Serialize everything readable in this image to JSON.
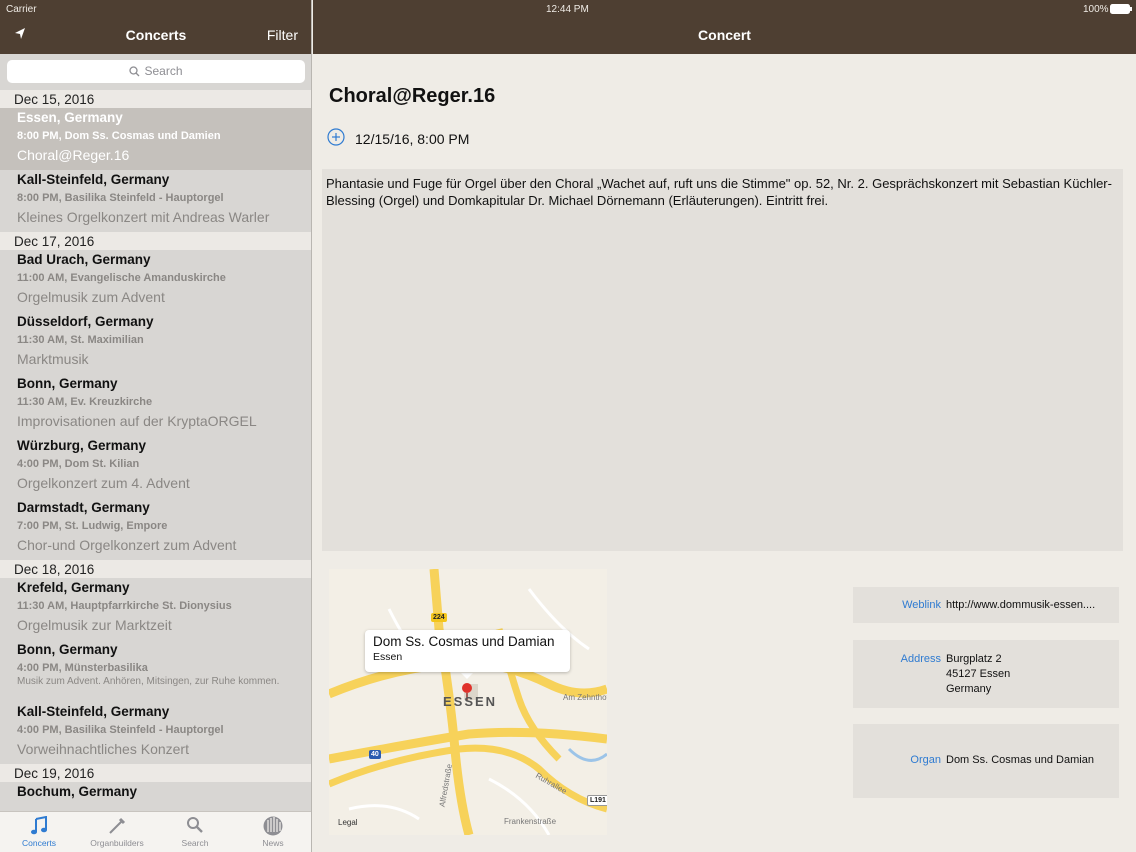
{
  "status": {
    "carrier": "Carrier",
    "time": "12:44 PM",
    "battery": "100%"
  },
  "sidebar": {
    "nav_title": "Concerts",
    "filter_label": "Filter",
    "search_placeholder": "Search",
    "sections": [
      {
        "date": "Dec 15, 2016",
        "items": [
          {
            "city": "Essen, Germany",
            "detail": "8:00 PM, Dom Ss. Cosmas und Damien",
            "title": "Choral@Reger.16",
            "selected": true
          },
          {
            "city": "Kall-Steinfeld, Germany",
            "detail": "8:00 PM, Basilika Steinfeld  -  Hauptorgel",
            "title": "Kleines Orgelkonzert mit Andreas Warler"
          }
        ]
      },
      {
        "date": "Dec 17, 2016",
        "items": [
          {
            "city": "Bad Urach, Germany",
            "detail": "11:00 AM, Evangelische Amanduskirche",
            "title": "Orgelmusik zum Advent"
          },
          {
            "city": "Düsseldorf, Germany",
            "detail": "11:30 AM, St. Maximilian",
            "title": "Marktmusik"
          },
          {
            "city": "Bonn, Germany",
            "detail": "11:30 AM, Ev. Kreuzkirche",
            "title": "Improvisationen auf der KryptaORGEL"
          },
          {
            "city": "Würzburg, Germany",
            "detail": "4:00 PM, Dom St. Kilian",
            "title": "Orgelkonzert zum 4. Advent"
          },
          {
            "city": "Darmstadt, Germany",
            "detail": "7:00 PM, St. Ludwig, Empore",
            "title": "Chor-und Orgelkonzert zum Advent"
          }
        ]
      },
      {
        "date": "Dec 18, 2016",
        "items": [
          {
            "city": "Krefeld, Germany",
            "detail": "11:30 AM, Hauptpfarrkirche St. Dionysius",
            "title": "Orgelmusik zur Marktzeit"
          },
          {
            "city": "Bonn, Germany",
            "detail": "4:00 PM, Münsterbasilika",
            "title": "Musik zum Advent. Anhören, Mitsingen, zur Ruhe kommen.",
            "multiline": true
          },
          {
            "city": "Kall-Steinfeld, Germany",
            "detail": "4:00 PM, Basilika Steinfeld  -  Hauptorgel",
            "title": "Vorweihnachtliches Konzert"
          }
        ]
      },
      {
        "date": "Dec 19, 2016",
        "items": [
          {
            "city": "Bochum, Germany",
            "detail": "",
            "title": "",
            "cut": true
          }
        ]
      }
    ],
    "tabs": [
      {
        "label": "Concerts",
        "icon": "music-note-icon",
        "active": true
      },
      {
        "label": "Organbuilders",
        "icon": "tools-icon"
      },
      {
        "label": "Search",
        "icon": "search-icon"
      },
      {
        "label": "News",
        "icon": "organ-pipes-icon"
      }
    ]
  },
  "detail": {
    "nav_title": "Concert",
    "title": "Choral@Reger.16",
    "datetime": "12/15/16, 8:00 PM",
    "description": "Phantasie und Fuge für Orgel über den Choral „Wachet auf, ruft uns die Stimme\" op. 52, Nr. 2. Gesprächskonzert mit Sebastian Küchler-Blessing (Orgel) und Domkapitular Dr. Michael Dörnemann (Erläuterungen). Eintritt frei.",
    "map": {
      "callout_title": "Dom Ss. Cosmas und Damian",
      "callout_subtitle": "Essen",
      "city_label": "ESSEN",
      "legal": "Legal",
      "streets": [
        "Alfredstraße",
        "Am Zehnthof",
        "Ruhrallee",
        "Frankenstraße",
        "224",
        "40",
        "L191"
      ]
    },
    "info": {
      "weblink_label": "Weblink",
      "weblink_value": "http://www.dommusik-essen....",
      "address_label": "Address",
      "address_lines": [
        "Burgplatz 2",
        "45127 Essen",
        "Germany"
      ],
      "organ_label": "Organ",
      "organ_value": "Dom Ss. Cosmas und Damian"
    }
  },
  "colors": {
    "navbar": "#4e3f32",
    "accent": "#2f7bd1",
    "selected_row": "#c5c1bc",
    "pin": "#e0322b"
  }
}
